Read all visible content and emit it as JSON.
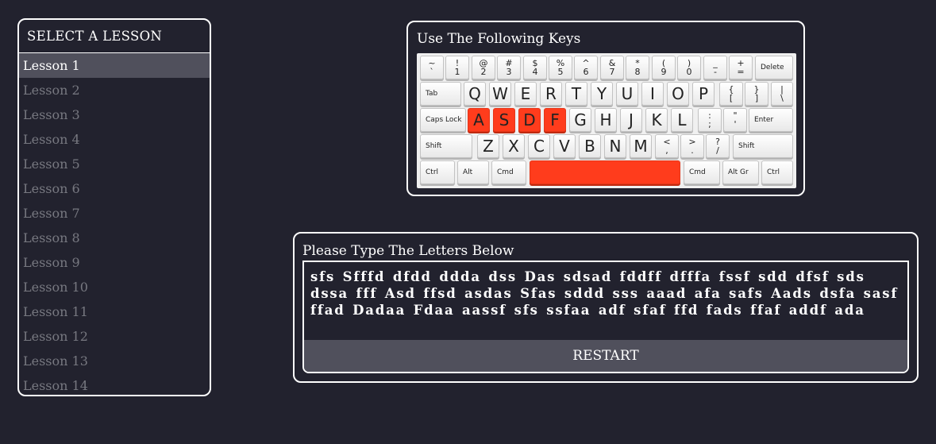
{
  "lessons": {
    "header": "SELECT A LESSON",
    "items": [
      "Lesson 1",
      "Lesson 2",
      "Lesson 3",
      "Lesson 4",
      "Lesson 5",
      "Lesson 6",
      "Lesson 7",
      "Lesson 8",
      "Lesson 9",
      "Lesson 10",
      "Lesson 11",
      "Lesson 12",
      "Lesson 13",
      "Lesson 14"
    ],
    "selected": "Lesson 1"
  },
  "keys_panel": {
    "title": "Use The Following Keys",
    "highlight_color": "#ff3c1c",
    "highlighted_keys": [
      "A",
      "S",
      "D",
      "F",
      "Space"
    ],
    "rows": [
      [
        {
          "top": "~",
          "bottom": "`"
        },
        {
          "top": "!",
          "bottom": "1"
        },
        {
          "top": "@",
          "bottom": "2"
        },
        {
          "top": "#",
          "bottom": "3"
        },
        {
          "top": "$",
          "bottom": "4"
        },
        {
          "top": "%",
          "bottom": "5"
        },
        {
          "top": "^",
          "bottom": "6"
        },
        {
          "top": "&",
          "bottom": "7"
        },
        {
          "top": "*",
          "bottom": "8"
        },
        {
          "top": "(",
          "bottom": "9"
        },
        {
          "top": ")",
          "bottom": "0"
        },
        {
          "top": "_",
          "bottom": "-"
        },
        {
          "top": "+",
          "bottom": "="
        },
        {
          "label": "Delete"
        }
      ],
      [
        {
          "label": "Tab"
        },
        {
          "label": "Q"
        },
        {
          "label": "W"
        },
        {
          "label": "E"
        },
        {
          "label": "R"
        },
        {
          "label": "T"
        },
        {
          "label": "Y"
        },
        {
          "label": "U"
        },
        {
          "label": "I"
        },
        {
          "label": "O"
        },
        {
          "label": "P"
        },
        {
          "top": "{",
          "bottom": "["
        },
        {
          "top": "}",
          "bottom": "]"
        },
        {
          "top": "|",
          "bottom": "\\"
        }
      ],
      [
        {
          "label": "Caps Lock"
        },
        {
          "label": "A"
        },
        {
          "label": "S"
        },
        {
          "label": "D"
        },
        {
          "label": "F"
        },
        {
          "label": "G"
        },
        {
          "label": "H"
        },
        {
          "label": "J"
        },
        {
          "label": "K"
        },
        {
          "label": "L"
        },
        {
          "top": ":",
          "bottom": ";"
        },
        {
          "top": "\"",
          "bottom": "'"
        },
        {
          "label": "Enter"
        }
      ],
      [
        {
          "label": "Shift"
        },
        {
          "label": "Z"
        },
        {
          "label": "X"
        },
        {
          "label": "C"
        },
        {
          "label": "V"
        },
        {
          "label": "B"
        },
        {
          "label": "N"
        },
        {
          "label": "M"
        },
        {
          "top": "<",
          "bottom": ","
        },
        {
          "top": ">",
          "bottom": "."
        },
        {
          "top": "?",
          "bottom": "/"
        },
        {
          "label": "Shift"
        }
      ],
      [
        {
          "label": "Ctrl"
        },
        {
          "label": "Alt"
        },
        {
          "label": "Cmd"
        },
        {
          "label": "Space"
        },
        {
          "label": "Cmd"
        },
        {
          "label": "Alt Gr"
        },
        {
          "label": "Ctrl"
        }
      ]
    ]
  },
  "type_panel": {
    "title": "Please Type The Letters Below",
    "text": "sfs Sfffd dfdd ddda dss Das sdsad fddff dfffa fssf sdd dfsf sds dssa fff Asd ffsd asdas Sfas sddd sss aaad afa safs Aads dsfa sasf ffad Dadaa Fdaa aassf sfs ssfaa adf sfaf ffd fads ffaf addf ada",
    "restart_label": "RESTART"
  }
}
